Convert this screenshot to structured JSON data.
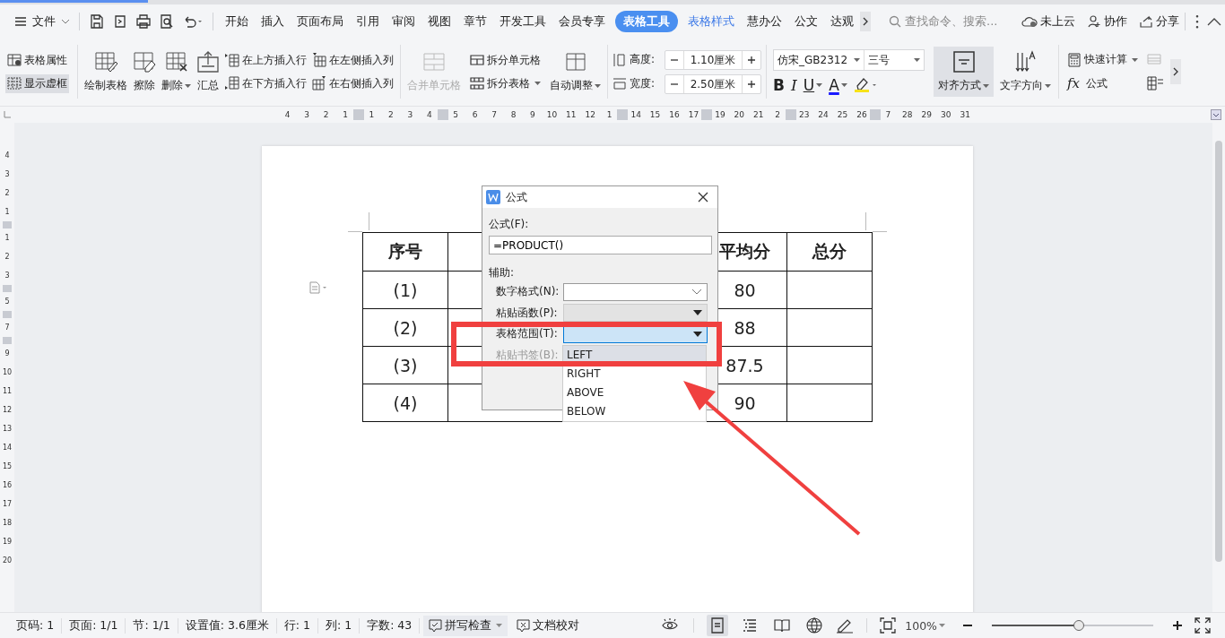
{
  "menu_bar": {
    "file_menu": "文件",
    "tabs": [
      {
        "label": "开始",
        "selected": false,
        "contextual": false
      },
      {
        "label": "插入",
        "selected": false,
        "contextual": false
      },
      {
        "label": "页面布局",
        "selected": false,
        "contextual": false
      },
      {
        "label": "引用",
        "selected": false,
        "contextual": false
      },
      {
        "label": "审阅",
        "selected": false,
        "contextual": false
      },
      {
        "label": "视图",
        "selected": false,
        "contextual": false
      },
      {
        "label": "章节",
        "selected": false,
        "contextual": false
      },
      {
        "label": "开发工具",
        "selected": false,
        "contextual": false
      },
      {
        "label": "会员专享",
        "selected": false,
        "contextual": false
      },
      {
        "label": "表格工具",
        "selected": true,
        "contextual": true
      },
      {
        "label": "表格样式",
        "selected": false,
        "contextual": true
      },
      {
        "label": "慧办公",
        "selected": false,
        "contextual": false
      },
      {
        "label": "公文",
        "selected": false,
        "contextual": false
      },
      {
        "label": "达观",
        "selected": false,
        "contextual": false
      }
    ],
    "search": {
      "placeholder": "查找命令、搜索..."
    },
    "cloud": "未上云",
    "collaborate": "协作",
    "share": "分享"
  },
  "ribbon": {
    "table_properties": "表格属性",
    "show_gridlines": {
      "label": "显示虚框",
      "on": true
    },
    "draw_table": "绘制表格",
    "erase": "擦除",
    "delete": "删除",
    "summary": "汇总",
    "insert_above": "在上方插入行",
    "insert_below": "在下方插入行",
    "insert_left": "在左侧插入列",
    "insert_right": "在右侧插入列",
    "merge_cells": {
      "label": "合并单元格",
      "disabled": true
    },
    "split_cells": "拆分单元格",
    "split_table": "拆分表格",
    "autofit": "自动调整",
    "height": {
      "label": "高度:",
      "value": "1.10厘米"
    },
    "width": {
      "label": "宽度:",
      "value": "2.50厘米"
    },
    "font": "仿宋_GB2312",
    "font_size": "三号",
    "bold": "B",
    "italic": "I",
    "underline": "U",
    "font_color": "A",
    "alignment": {
      "label": "对齐方式",
      "on": true
    },
    "text_direction": "文字方向",
    "quick_calc": "快速计算",
    "formula_mark": "fx",
    "formula": "公式"
  },
  "ruler": [
    {
      "label": "4"
    },
    {
      "label": "3"
    },
    {
      "label": "2"
    },
    {
      "label": "1"
    },
    {
      "kind": "grip"
    },
    {
      "label": "1"
    },
    {
      "label": "2"
    },
    {
      "label": "3"
    },
    {
      "label": "4"
    },
    {
      "kind": "grip"
    },
    {
      "label": "5"
    },
    {
      "label": "6"
    },
    {
      "label": "7"
    },
    {
      "label": "8"
    },
    {
      "label": "9"
    },
    {
      "label": "10"
    },
    {
      "label": "11"
    },
    {
      "label": "12"
    },
    {
      "label": "1"
    },
    {
      "kind": "grip"
    },
    {
      "label": "14"
    },
    {
      "label": "15"
    },
    {
      "label": "16"
    },
    {
      "label": "17"
    },
    {
      "kind": "grip"
    },
    {
      "label": "19"
    },
    {
      "label": "20"
    },
    {
      "label": "21"
    },
    {
      "label": "2"
    },
    {
      "kind": "grip"
    },
    {
      "label": "23"
    },
    {
      "label": "24"
    },
    {
      "label": "25"
    },
    {
      "label": "26"
    },
    {
      "kind": "grip"
    },
    {
      "label": "7"
    },
    {
      "label": "28"
    },
    {
      "label": "29"
    },
    {
      "label": "30"
    },
    {
      "label": "31"
    }
  ],
  "vertical_ruler": [
    {
      "label": "4"
    },
    {
      "label": "3"
    },
    {
      "label": "2"
    },
    {
      "label": "1"
    },
    {
      "kind": "grip"
    },
    {
      "label": "1"
    },
    {
      "label": "2"
    },
    {
      "label": "3"
    },
    {
      "kind": "grip"
    },
    {
      "label": "5"
    },
    {
      "kind": "grip"
    },
    {
      "label": "7"
    },
    {
      "kind": "grip"
    },
    {
      "label": "9"
    },
    {
      "label": "10"
    },
    {
      "label": "11"
    },
    {
      "label": "12"
    },
    {
      "label": "13"
    },
    {
      "label": "14"
    },
    {
      "label": "15"
    },
    {
      "label": "16"
    },
    {
      "label": "17"
    },
    {
      "label": "18"
    },
    {
      "label": "19"
    },
    {
      "label": "20"
    }
  ],
  "table": {
    "header": {
      "number": "序号",
      "average": "平均分",
      "total": "总分"
    },
    "rows": [
      {
        "number": "(1)",
        "average": "80"
      },
      {
        "number": "(2)",
        "average": "88"
      },
      {
        "number": "(3)",
        "average": "87.5"
      },
      {
        "number": "(4)",
        "average": "90"
      }
    ]
  },
  "dialog": {
    "title": "公式",
    "formula_label": "公式(F):",
    "formula_value": "=PRODUCT()",
    "assist_label": "辅助:",
    "fields": [
      {
        "label": "数字格式(N):",
        "kind": "select",
        "disabled": false,
        "focused": false
      },
      {
        "label": "粘贴函数(P):",
        "kind": "select",
        "disabled": true,
        "focused": false
      },
      {
        "label": "表格范围(T):",
        "kind": "select",
        "disabled": false,
        "focused": true
      },
      {
        "label": "粘贴书签(B):",
        "kind": "label",
        "disabled": true
      }
    ],
    "dropdown": [
      {
        "label": "LEFT",
        "selected": true
      },
      {
        "label": "RIGHT",
        "selected": false
      },
      {
        "label": "ABOVE",
        "selected": false
      },
      {
        "label": "BELOW",
        "selected": false
      }
    ]
  },
  "status_bar": {
    "items": [
      "页码: 1",
      "页面: 1/1",
      "节: 1/1",
      "设置值: 3.6厘米",
      "行: 1",
      "列: 1",
      "字数: 43"
    ],
    "spell_check": "拼写检查",
    "proofread": "文档校对",
    "views": [
      {
        "selected": false
      },
      {
        "selected": true
      },
      {
        "selected": false
      },
      {
        "selected": false
      },
      {
        "selected": false
      }
    ],
    "zoom": {
      "value": "100%",
      "level": 0.54
    }
  }
}
